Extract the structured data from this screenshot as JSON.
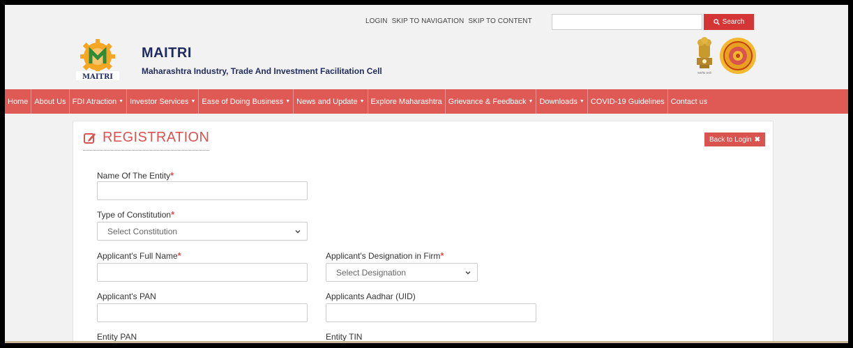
{
  "topbar": {
    "links": [
      "LOGIN",
      "SKIP TO NAVIGATION",
      "SKIP TO CONTENT"
    ],
    "search_placeholder": "",
    "search_label": "Search"
  },
  "header": {
    "logo_text": "MAITRI",
    "title": "MAITRI",
    "subtitle": "Maharashtra Industry, Trade And Investment Facilitation Cell",
    "emblem_caption": "सत्यमेव जयते"
  },
  "nav": {
    "items": [
      {
        "label": "Home",
        "dropdown": false
      },
      {
        "label": "About Us",
        "dropdown": false
      },
      {
        "label": "FDI Atraction",
        "dropdown": true
      },
      {
        "label": "Investor Services",
        "dropdown": true
      },
      {
        "label": "Ease of Doing Business",
        "dropdown": true
      },
      {
        "label": "News and Update",
        "dropdown": true
      },
      {
        "label": "Explore Maharashtra",
        "dropdown": false
      },
      {
        "label": "Grievance & Feedback",
        "dropdown": true
      },
      {
        "label": "Downloads",
        "dropdown": true
      },
      {
        "label": "COVID-19 Guidelines",
        "dropdown": false
      },
      {
        "label": "Contact us",
        "dropdown": false
      }
    ]
  },
  "form": {
    "title": "REGISTRATION",
    "back_label": "Back to Login",
    "entity_name_label": "Name Of The Entity",
    "constitution_label": "Type of Constitution",
    "constitution_selected": "Select Constitution",
    "applicant_name_label": "Applicant's Full Name",
    "designation_label": "Applicant's Designation in Firm",
    "designation_selected": "Select Designation",
    "applicant_pan_label": "Applicant's PAN",
    "aadhar_label": "Applicants Aadhar (UID)",
    "entity_pan_label": "Entity PAN",
    "entity_tin_label": "Entity TIN",
    "required_mark": "*"
  },
  "colors": {
    "nav_bg": "#e05a55",
    "accent": "#d9534f",
    "brand_navy": "#1f2b5e"
  }
}
